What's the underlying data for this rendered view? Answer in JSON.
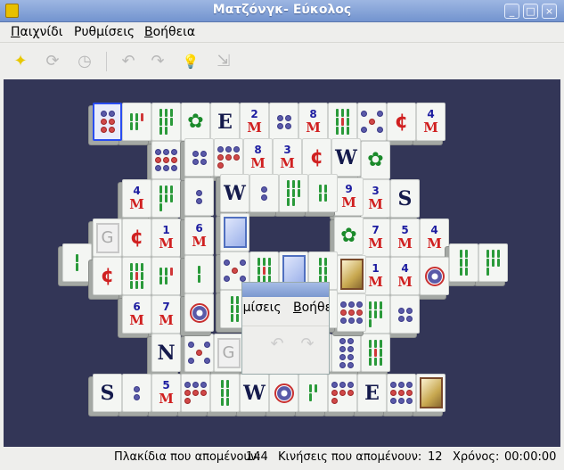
{
  "window": {
    "title": "Ματζόνγκ- Εύκολος",
    "buttons": {
      "minimize": "_",
      "maximize": "□",
      "close": "×"
    }
  },
  "menu": [
    {
      "label": "Παιχνίδι",
      "mnemonic": "Π",
      "rest": "αιχνίδι"
    },
    {
      "label": "Ρυθμίσεις",
      "mnemonic": "",
      "rest": "Ρυθμίσεις"
    },
    {
      "label": "Βοήθεια",
      "mnemonic": "Β",
      "rest": "οήθεια"
    }
  ],
  "toolbar": [
    {
      "icon": "new-game-icon",
      "glyph": "✦",
      "enabled": true
    },
    {
      "icon": "restart-icon",
      "glyph": "⟳",
      "enabled": false
    },
    {
      "icon": "pause-icon",
      "glyph": "◷",
      "enabled": false
    },
    {
      "icon": "undo-icon",
      "glyph": "↶",
      "enabled": false
    },
    {
      "icon": "redo-icon",
      "glyph": "↷",
      "enabled": false
    },
    {
      "icon": "hint-icon",
      "glyph": "💡",
      "enabled": true
    },
    {
      "icon": "shuffle-icon",
      "glyph": "⇲",
      "enabled": false
    }
  ],
  "popup": {
    "menu_left": "θμίσεις",
    "menu_right_mn": "Β",
    "menu_right": "οήθε"
  },
  "tiles": [
    "dots-6",
    "bam-5",
    "bam-8",
    "dragon-green",
    "wind-E",
    "char-2",
    "dots-4",
    "char-8",
    "bam-9",
    "dots-5",
    "dragon-red",
    "char-4",
    "dots-9",
    "dots-4",
    "dots-7",
    "char-8",
    "char-3",
    "dragon-red",
    "wind-W",
    "dragon-green",
    "char-4",
    "bam-7",
    "dots-2",
    "wind-W",
    "dots-2",
    "bam-8",
    "bam-4",
    "char-9",
    "char-3",
    "wind-S",
    "bam-2",
    "gnome",
    "dragon-red",
    "char-1",
    "char-6",
    "season",
    "dragon-green",
    "char-7",
    "char-5",
    "char-4",
    "bam-6",
    "bam-7",
    "dragon-red",
    "bam-9",
    "bam-5",
    "bam-2",
    "dots-5",
    "bam-9",
    "season",
    "bam-6",
    "flower",
    "char-1",
    "char-4",
    "dots-1",
    "char-6",
    "char-7",
    "dots-1",
    "bam-6",
    "dots-8",
    "char-6",
    "wind-S",
    "dots-9",
    "bam-7",
    "dots-4",
    "wind-N",
    "dots-5",
    "gnome",
    "dots-2",
    "char-6",
    "char-9",
    "dots-8",
    "bam-9",
    "wind-S",
    "dots-2",
    "char-5",
    "dots-7",
    "bam-6",
    "wind-W",
    "dots-1",
    "bam-3",
    "dots-7",
    "wind-E",
    "dots-9",
    "flower"
  ],
  "selected_tile": 0,
  "status": {
    "tiles_label": "Πλακίδια που απομένουν:",
    "tiles_left": "144",
    "moves_label": "Κινήσεις που απομένουν:",
    "moves_left": "12",
    "time_label": "Χρόνος:",
    "time": "00:00:00"
  }
}
